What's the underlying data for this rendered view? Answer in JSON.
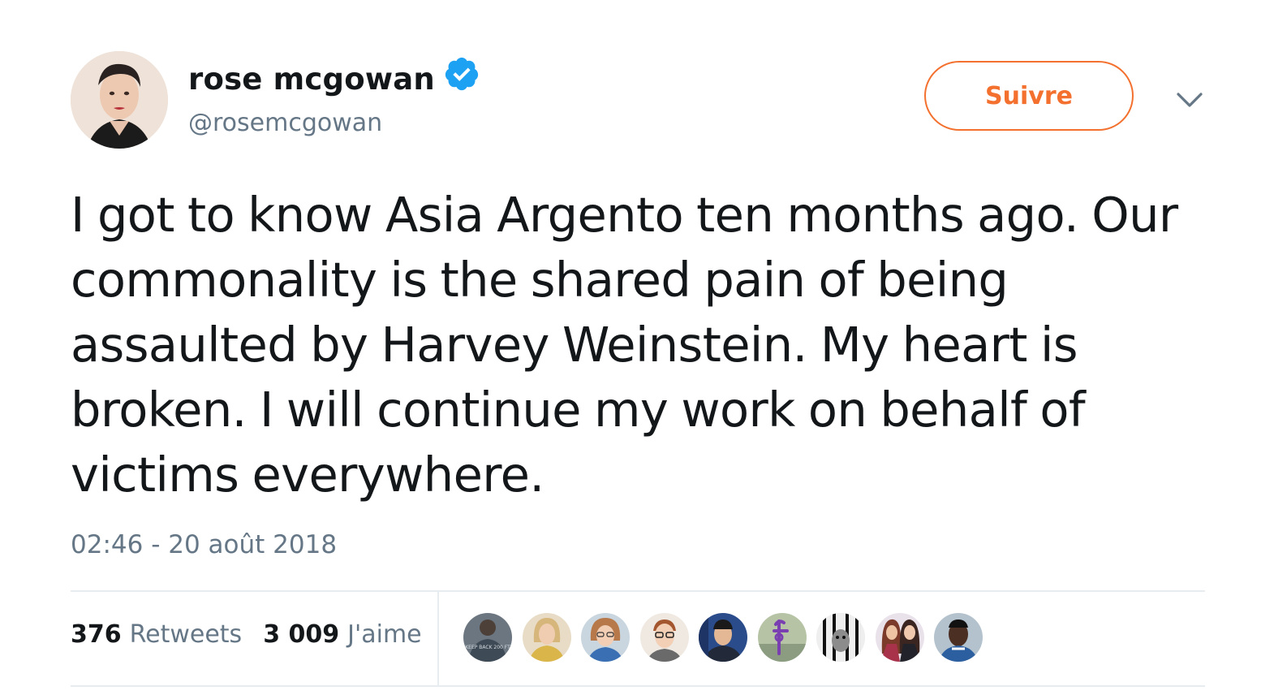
{
  "author": {
    "display_name": "rose mcgowan",
    "handle": "@rosemcgowan",
    "verified": true,
    "avatar_icon": "profile-photo"
  },
  "follow_button": {
    "label": "Suivre",
    "color": "#f3702e"
  },
  "menu_icon": "chevron-down-icon",
  "tweet": {
    "text": "I got to know Asia Argento ten months ago. Our commonality is the shared pain of being assaulted by Harvey Weinstein. My heart is broken. I will continue my work on behalf of victims everywhere.",
    "timestamp": "02:46 - 20 août 2018"
  },
  "stats": {
    "retweets": {
      "count": "376",
      "label": "Retweets"
    },
    "likes": {
      "count": "3 009",
      "label": "J'aime"
    }
  },
  "likers": [
    {
      "name": "liker-1",
      "shirt_text": "KEEP BACK 200 FT"
    },
    {
      "name": "liker-2"
    },
    {
      "name": "liker-3"
    },
    {
      "name": "liker-4"
    },
    {
      "name": "liker-5"
    },
    {
      "name": "liker-6"
    },
    {
      "name": "liker-7"
    },
    {
      "name": "liker-8"
    },
    {
      "name": "liker-9"
    }
  ],
  "colors": {
    "text_primary": "#14171a",
    "text_secondary": "#657786",
    "verified_blue": "#1da1f2",
    "divider": "#e6ecf0",
    "accent_orange": "#f3702e"
  }
}
